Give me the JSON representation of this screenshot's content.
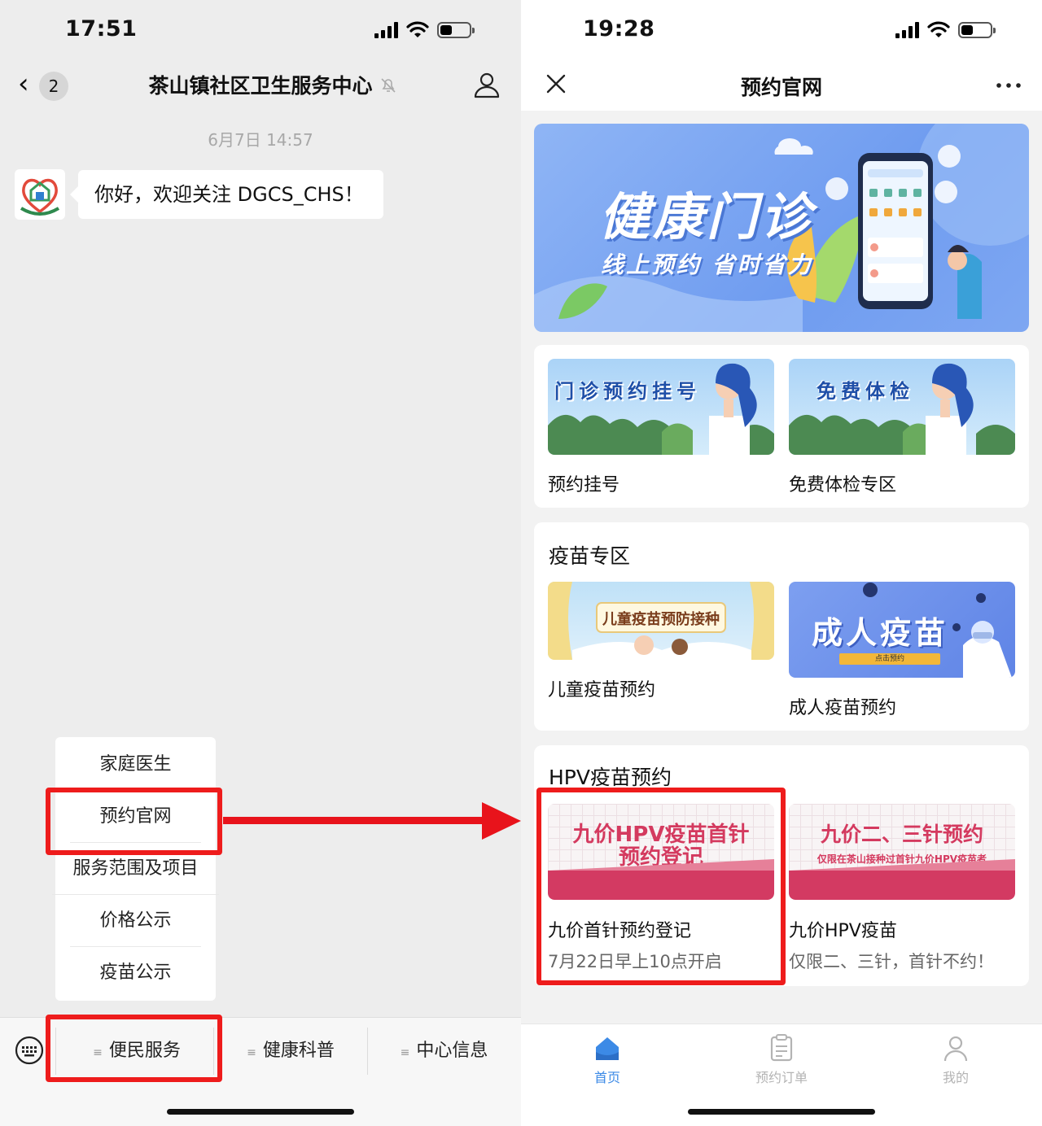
{
  "left": {
    "status": {
      "time": "17:51"
    },
    "header": {
      "unread": "2",
      "title": "茶山镇社区卫生服务中心"
    },
    "chat": {
      "timestamp": "6月7日 14:57",
      "message": "你好，欢迎关注 DGCS_CHS！"
    },
    "popup_menu": {
      "items": [
        "家庭医生",
        "预约官网",
        "服务范围及项目",
        "价格公示",
        "疫苗公示"
      ]
    },
    "menu_bar": {
      "items": [
        "便民服务",
        "健康科普",
        "中心信息"
      ]
    }
  },
  "right": {
    "status": {
      "time": "19:28"
    },
    "header": {
      "title": "预约官网"
    },
    "banner": {
      "title": "健康门诊",
      "subtitle": "线上预约 省时省力"
    },
    "services": [
      {
        "caption": "门诊预约挂号",
        "label": "预约挂号"
      },
      {
        "caption": "免费体检",
        "label": "免费体检专区"
      }
    ],
    "vaccine": {
      "title": "疫苗专区",
      "children": {
        "caption": "儿童疫苗预防接种",
        "label": "儿童疫苗预约"
      },
      "adult": {
        "caption": "成人疫苗",
        "button": "点击预约",
        "label": "成人疫苗预约"
      }
    },
    "hpv": {
      "title": "HPV疫苗预约",
      "items": [
        {
          "line1": "九价HPV疫苗首针",
          "line2": "预约登记",
          "label": "九价首针预约登记",
          "sub": "7月22日早上10点开启"
        },
        {
          "line1": "九价二、三针预约",
          "line2": "仅限在茶山接种过首针九价HPV疫苗者",
          "label": "九价HPV疫苗",
          "sub": "仅限二、三针，首针不约！"
        }
      ]
    },
    "tabbar": {
      "items": [
        "首页",
        "预约订单",
        "我的"
      ],
      "active": 0
    }
  },
  "colors": {
    "highlight": "#ee1c1c",
    "arrow": "#e8131b",
    "accent": "#3c8ae6",
    "inactive": "#b3b3b3"
  }
}
